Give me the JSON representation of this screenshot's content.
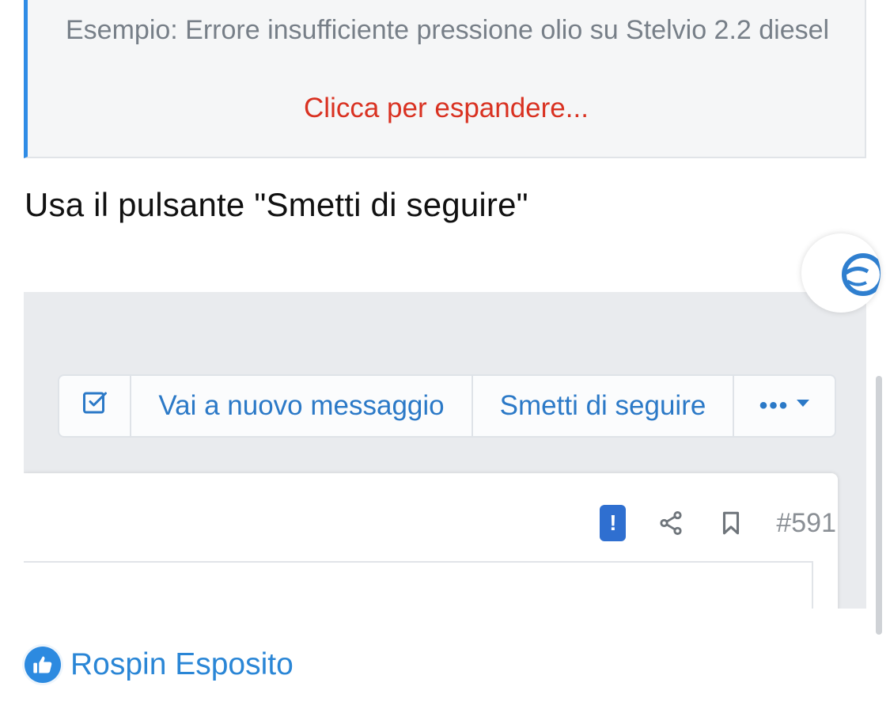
{
  "quote": {
    "text": "Esempio: Errore insufficiente pressione olio su Stelvio 2.2 diesel",
    "expand_label": "Clicca per espandere..."
  },
  "instruction": "Usa il pulsante \"Smetti di seguire\"",
  "embedded_screenshot": {
    "button_group": {
      "check_icon": "checkbox-icon",
      "new_message_label": "Vai a nuovo messaggio",
      "unfollow_label": "Smetti di seguire",
      "more_label": "•••"
    },
    "post_actions": {
      "report_label": "!",
      "share_icon": "share-icon",
      "bookmark_icon": "bookmark-icon",
      "post_number": "#591"
    }
  },
  "reaction": {
    "icon": "thumbs-up-icon",
    "user": "Rospin Esposito"
  },
  "colors": {
    "accent_blue": "#2b79c7",
    "expand_red": "#d93222",
    "quote_border": "#2f8ce6",
    "link_blue": "#2a86d6"
  }
}
